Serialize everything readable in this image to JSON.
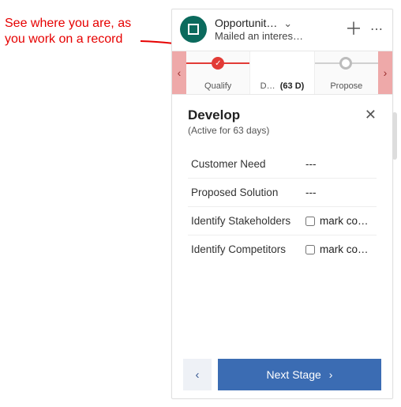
{
  "annotation": {
    "text": "See where you are, as\nyou work on a record"
  },
  "header": {
    "title": "Opportunit…",
    "subtitle": "Mailed an interes…"
  },
  "stages": {
    "items": [
      {
        "label": "Qualify",
        "state": "complete"
      },
      {
        "label": "D…",
        "days": "(63 D)",
        "state": "current"
      },
      {
        "label": "Propose",
        "state": "future"
      }
    ]
  },
  "card": {
    "title": "Develop",
    "subtitle": "(Active for 63 days)",
    "fields": [
      {
        "label": "Customer Need",
        "value": "---",
        "type": "text"
      },
      {
        "label": "Proposed Solution",
        "value": "---",
        "type": "text"
      },
      {
        "label": "Identify Stakeholders",
        "value": "mark co…",
        "type": "check"
      },
      {
        "label": "Identify Competitors",
        "value": "mark co…",
        "type": "check"
      }
    ]
  },
  "footer": {
    "next_label": "Next Stage"
  }
}
